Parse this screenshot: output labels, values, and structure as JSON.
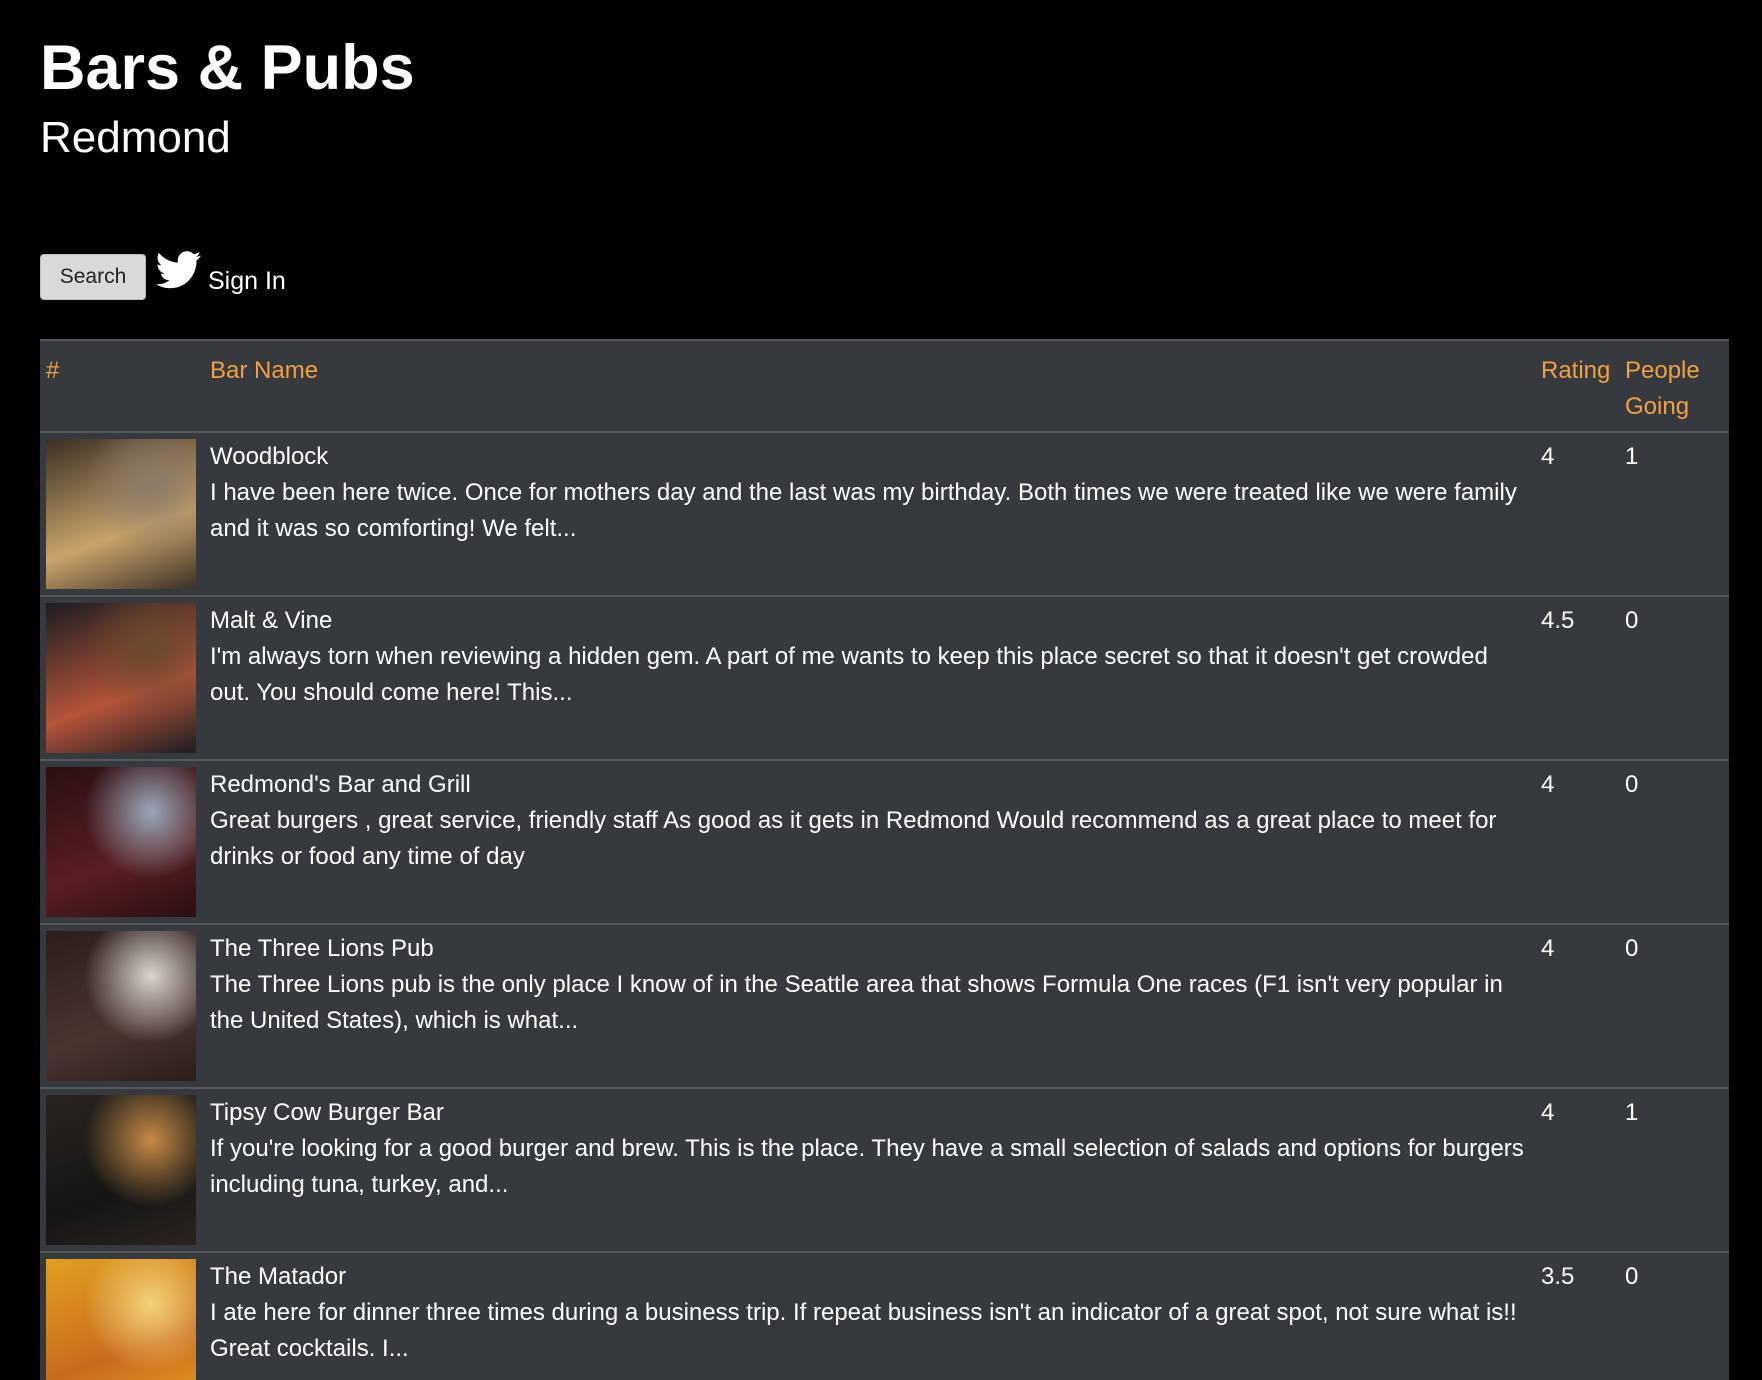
{
  "header": {
    "title": "Bars & Pubs",
    "location": "Redmond"
  },
  "actions": {
    "search_label": "Search",
    "signin_label": "Sign In",
    "signin_icon": "twitter-icon"
  },
  "table": {
    "columns": [
      "#",
      "Bar Name",
      "Rating",
      "People Going"
    ],
    "rows": [
      {
        "name": "Woodblock",
        "snippet": "I have been here twice. Once for mothers day and the last was my birthday. Both times we were treated like we were family and it was so comforting! We felt...",
        "rating": "4",
        "going": "1",
        "thumb_colors": [
          "#3a3026",
          "#c9a36a",
          "#8c7c6a"
        ]
      },
      {
        "name": "Malt & Vine",
        "snippet": "I'm always torn when reviewing a hidden gem. A part of me wants to keep this place secret so that it doesn't get crowded out. You should come here! This...",
        "rating": "4.5",
        "going": "0",
        "thumb_colors": [
          "#1b1d22",
          "#b5543a",
          "#6b4a2e"
        ]
      },
      {
        "name": "Redmond's Bar and Grill",
        "snippet": "Great burgers , great service, friendly staff As good as it gets in Redmond Would recommend as a great place to meet for drinks or food any time of day",
        "rating": "4",
        "going": "0",
        "thumb_colors": [
          "#2a0f12",
          "#5a1e22",
          "#9aa7b8"
        ]
      },
      {
        "name": "The Three Lions Pub",
        "snippet": "The Three Lions pub is the only place I know of in the Seattle area that shows Formula One races (F1 isn't very popular in the United States), which is what...",
        "rating": "4",
        "going": "0",
        "thumb_colors": [
          "#2b1e1c",
          "#4a3430",
          "#d9d4cc"
        ]
      },
      {
        "name": "Tipsy Cow Burger Bar",
        "snippet": "If you're looking for a good burger and brew. This is the place. They have a small selection of salads and options for burgers including tuna, turkey, and...",
        "rating": "4",
        "going": "1",
        "thumb_colors": [
          "#2a2420",
          "#151515",
          "#c78a45"
        ]
      },
      {
        "name": "The Matador",
        "snippet": "I ate here for dinner three times during a business trip. If repeat business isn't an indicator of a great spot, not sure what is!! Great cocktails. I...",
        "rating": "3.5",
        "going": "0",
        "thumb_colors": [
          "#e0a020",
          "#c96a1e",
          "#f3d27a"
        ]
      }
    ]
  }
}
